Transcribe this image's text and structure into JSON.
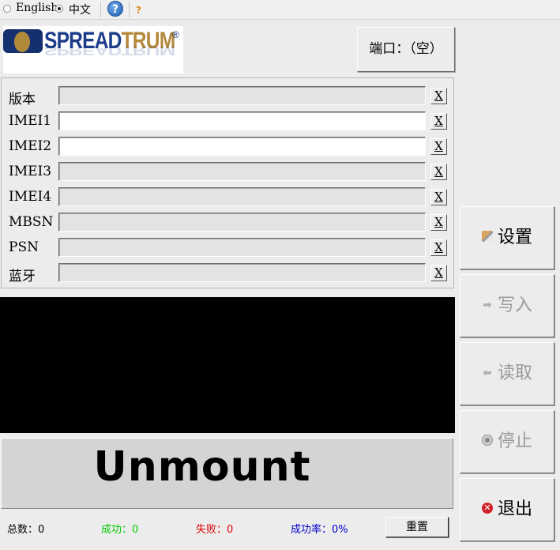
{
  "language": {
    "english_label": "English",
    "chinese_label": "中文",
    "selected": "中文"
  },
  "toolbar": {
    "help_glyph": "?",
    "whatsthis_glyph": "?"
  },
  "logo": {
    "brand_part1": "SPREAD",
    "brand_part2": "TRUM",
    "registered": "®"
  },
  "port_button": {
    "label": "端口：（空）"
  },
  "fields": [
    {
      "label": "版本",
      "value": "",
      "clear": "X"
    },
    {
      "label": "IMEI1",
      "value": "",
      "clear": "X"
    },
    {
      "label": "IMEI2",
      "value": "",
      "clear": "X"
    },
    {
      "label": "IMEI3",
      "value": "",
      "clear": "X"
    },
    {
      "label": "IMEI4",
      "value": "",
      "clear": "X"
    },
    {
      "label": "MBSN",
      "value": "",
      "clear": "X"
    },
    {
      "label": "PSN",
      "value": "",
      "clear": "X"
    },
    {
      "label": "蓝牙",
      "value": "",
      "clear": "X"
    }
  ],
  "status": {
    "text": "Unmount"
  },
  "stats": {
    "total": "总数：0",
    "success": "成功：0",
    "failure": "失败：0",
    "rate": "成功率：0%",
    "reset_label": "重置"
  },
  "side_buttons": {
    "settings": "设置",
    "write": "写入",
    "read": "读取",
    "stop": "停止",
    "exit": "退出"
  },
  "colors": {
    "success": "#00cc00",
    "failure": "#e00000",
    "rate": "#0000cc",
    "log_background": "#000000",
    "exit_icon": "#d0202a"
  },
  "icons": {
    "help": "help-icon",
    "whatsthis": "whatsthis-icon",
    "settings": "settings-icon",
    "write": "arrow-right-icon",
    "read": "arrow-left-icon",
    "stop": "stop-icon",
    "exit": "exit-icon"
  }
}
